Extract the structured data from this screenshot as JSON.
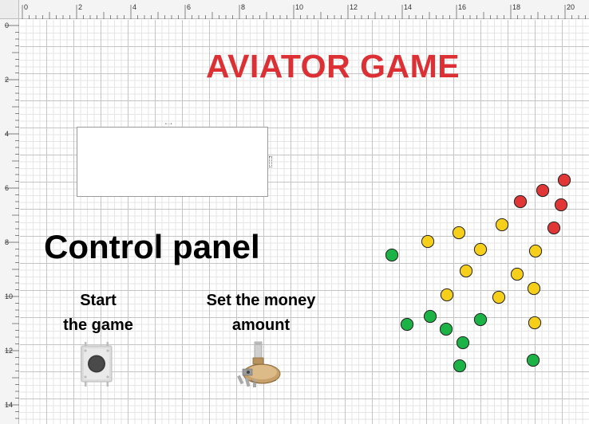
{
  "ruler": {
    "top_labels": [
      "0",
      "2",
      "4",
      "6",
      "8",
      "10",
      "12",
      "14",
      "16",
      "18",
      "20"
    ],
    "left_labels": [
      "0",
      "2",
      "4",
      "6",
      "8",
      "10",
      "12",
      "14"
    ]
  },
  "title": "AVIATOR GAME",
  "control_panel": {
    "heading": "Control panel",
    "start_label_line1": "Start",
    "start_label_line2": "the game",
    "money_label_line1": "Set the money",
    "money_label_line2": "amount"
  },
  "components": {
    "push_button": "push-button",
    "potentiometer": "potentiometer",
    "display": "display"
  },
  "colors": {
    "title": "#dc3035",
    "led_red": "#e03636",
    "led_yellow": "#f6cf1a",
    "led_green": "#1bb346"
  },
  "leds": [
    {
      "color": "red"
    },
    {
      "color": "red"
    },
    {
      "color": "red"
    },
    {
      "color": "red"
    },
    {
      "color": "red"
    },
    {
      "color": "yellow"
    },
    {
      "color": "yellow"
    },
    {
      "color": "yellow"
    },
    {
      "color": "yellow"
    },
    {
      "color": "yellow"
    },
    {
      "color": "yellow"
    },
    {
      "color": "yellow"
    },
    {
      "color": "yellow"
    },
    {
      "color": "yellow"
    },
    {
      "color": "yellow"
    },
    {
      "color": "yellow"
    },
    {
      "color": "green"
    },
    {
      "color": "green"
    },
    {
      "color": "green"
    },
    {
      "color": "green"
    },
    {
      "color": "green"
    },
    {
      "color": "green"
    },
    {
      "color": "green"
    },
    {
      "color": "green"
    },
    {
      "color": "green"
    }
  ]
}
